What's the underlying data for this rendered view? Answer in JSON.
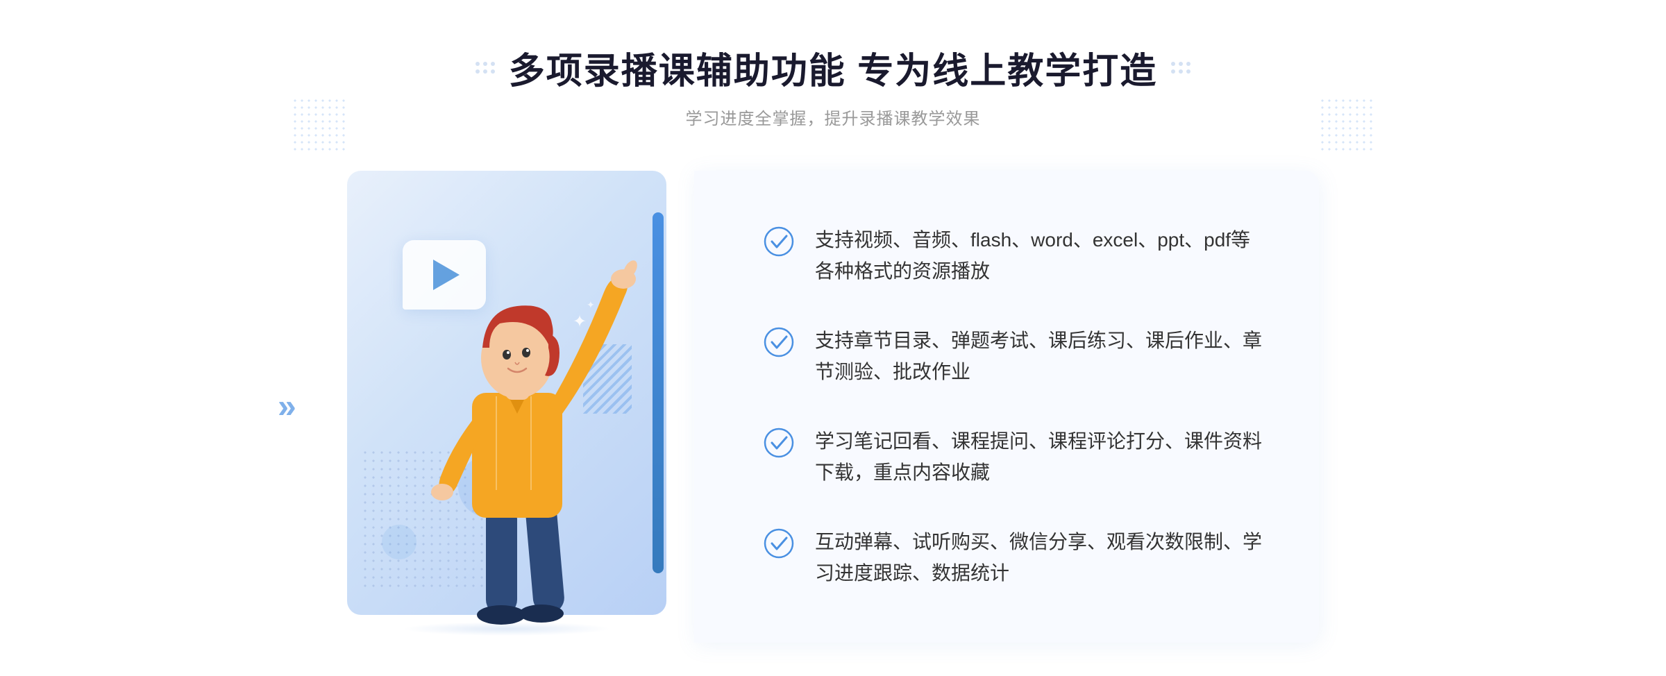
{
  "header": {
    "main_title": "多项录播课辅助功能 专为线上教学打造",
    "subtitle": "学习进度全掌握，提升录播课教学效果"
  },
  "features": [
    {
      "id": 1,
      "text": "支持视频、音频、flash、word、excel、ppt、pdf等各种格式的资源播放"
    },
    {
      "id": 2,
      "text": "支持章节目录、弹题考试、课后练习、课后作业、章节测验、批改作业"
    },
    {
      "id": 3,
      "text": "学习笔记回看、课程提问、课程评论打分、课件资料下载，重点内容收藏"
    },
    {
      "id": 4,
      "text": "互动弹幕、试听购买、微信分享、观看次数限制、学习进度跟踪、数据统计"
    }
  ],
  "icons": {
    "check_color": "#4a90e2",
    "title_dot_color": "#aac4e8",
    "chevron_color": "#4a90e2"
  }
}
